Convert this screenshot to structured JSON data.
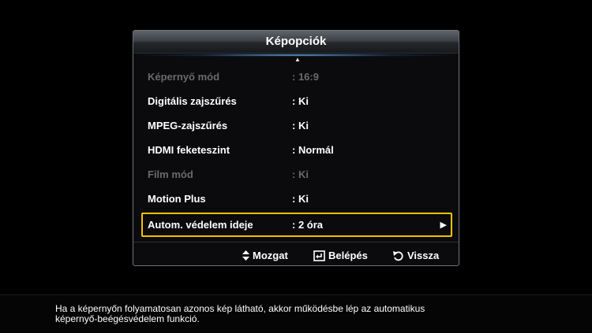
{
  "panel": {
    "title": "Képopciók",
    "items": [
      {
        "label": "Képernyő mód",
        "value": ":  16:9",
        "enabled": false
      },
      {
        "label": "Digitális zajszűrés",
        "value": ":  Ki",
        "enabled": true
      },
      {
        "label": "MPEG-zajszűrés",
        "value": ":  Ki",
        "enabled": true
      },
      {
        "label": "HDMI feketeszint",
        "value": ":  Normál",
        "enabled": true
      },
      {
        "label": "Film mód",
        "value": ":  Ki",
        "enabled": false
      },
      {
        "label": "Motion Plus",
        "value": ":  Ki",
        "enabled": true
      },
      {
        "label": "Autom. védelem ideje",
        "value": ":  2 óra",
        "enabled": true,
        "selected": true
      }
    ]
  },
  "footer": {
    "move_label": "Mozgat",
    "enter_label": "Belépés",
    "back_label": "Vissza"
  },
  "help": {
    "line1": "Ha a képernyőn folyamatosan azonos kép látható, akkor működésbe lép az automatikus",
    "line2": "képernyő-beégésvédelem funkció."
  },
  "colors": {
    "selection_border": "#f2c200",
    "disabled_text": "#6a6a6a"
  },
  "icons": [
    "scroll-up-icon",
    "submenu-arrow-icon",
    "updown-arrows-icon",
    "enter-icon",
    "return-icon"
  ]
}
